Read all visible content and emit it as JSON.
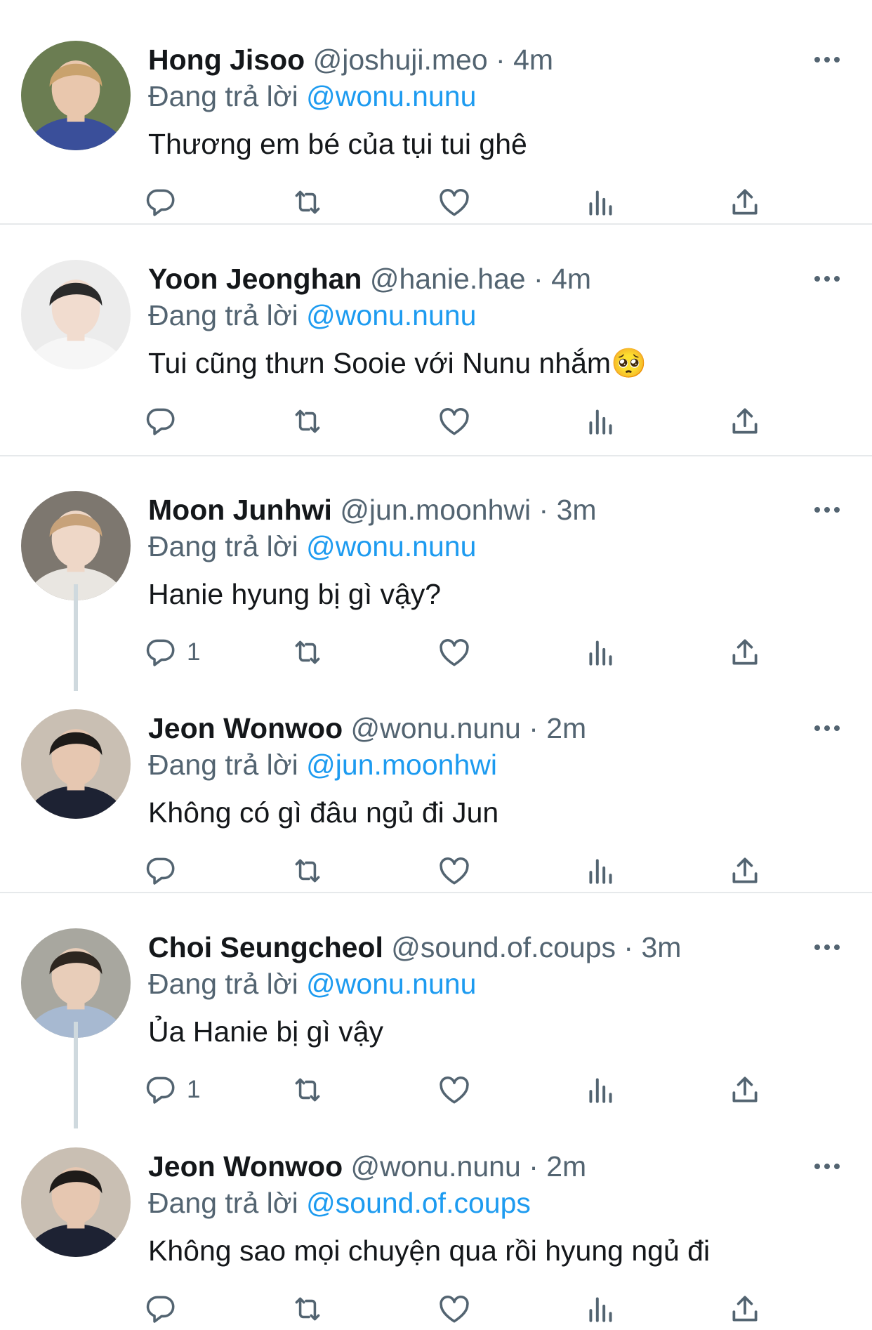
{
  "reply_prefix": "Đang trả lời",
  "tweets": [
    {
      "name": "Hong Jisoo",
      "handle": "@joshuji.meo",
      "separator": "·",
      "time": "4m",
      "reply_to": "@wonu.nunu",
      "text": "Thương em bé của tụi tui ghê",
      "reply_count": "",
      "avatar_colors": {
        "bg": "#6b7d52",
        "skin": "#e9c7ad",
        "hair": "#c9a26d",
        "shirt": "#3a4f9a"
      }
    },
    {
      "name": "Yoon Jeonghan",
      "handle": "@hanie.hae",
      "separator": "·",
      "time": "4m",
      "reply_to": "@wonu.nunu",
      "text": "Tui cũng thưn Sooie với Nunu nhắm🥺",
      "reply_count": "",
      "avatar_colors": {
        "bg": "#ececec",
        "skin": "#f1dccf",
        "hair": "#2a2a2a",
        "shirt": "#f6f6f6"
      }
    },
    {
      "name": "Moon Junhwi",
      "handle": "@jun.moonhwi",
      "separator": "·",
      "time": "3m",
      "reply_to": "@wonu.nunu",
      "text": "Hanie hyung bị gì vậy?",
      "reply_count": "1",
      "avatar_colors": {
        "bg": "#7d776f",
        "skin": "#eed7c7",
        "hair": "#c7a27a",
        "shirt": "#e9e6e1"
      }
    },
    {
      "name": "Jeon Wonwoo",
      "handle": "@wonu.nunu",
      "separator": "·",
      "time": "2m",
      "reply_to": "@jun.moonhwi",
      "text": "Không có gì đâu ngủ đi Jun",
      "reply_count": "",
      "avatar_colors": {
        "bg": "#c9bfb3",
        "skin": "#e6c7b1",
        "hair": "#1e1b19",
        "shirt": "#1d2233"
      }
    },
    {
      "name": "Choi Seungcheol",
      "handle": "@sound.of.coups",
      "separator": "·",
      "time": "3m",
      "reply_to": "@wonu.nunu",
      "text": "Ủa Hanie bị gì vậy",
      "reply_count": "1",
      "avatar_colors": {
        "bg": "#a8a79f",
        "skin": "#e8cdb9",
        "hair": "#2d2620",
        "shirt": "#a7b9d1"
      }
    },
    {
      "name": "Jeon Wonwoo",
      "handle": "@wonu.nunu",
      "separator": "·",
      "time": "2m",
      "reply_to": "@sound.of.coups",
      "text": "Không sao mọi chuyện qua rồi hyung ngủ đi",
      "reply_count": "",
      "avatar_colors": {
        "bg": "#c9bfb3",
        "skin": "#e6c7b1",
        "hair": "#1e1b19",
        "shirt": "#1d2233"
      }
    }
  ],
  "icons": [
    "reply-icon",
    "retweet-icon",
    "like-icon",
    "views-icon",
    "share-icon",
    "more-icon"
  ],
  "colors": {
    "accent": "#1d9bf0",
    "muted": "#536471",
    "icon": "#536471",
    "divider": "#e6e9eb",
    "thread": "#cfd9de"
  }
}
